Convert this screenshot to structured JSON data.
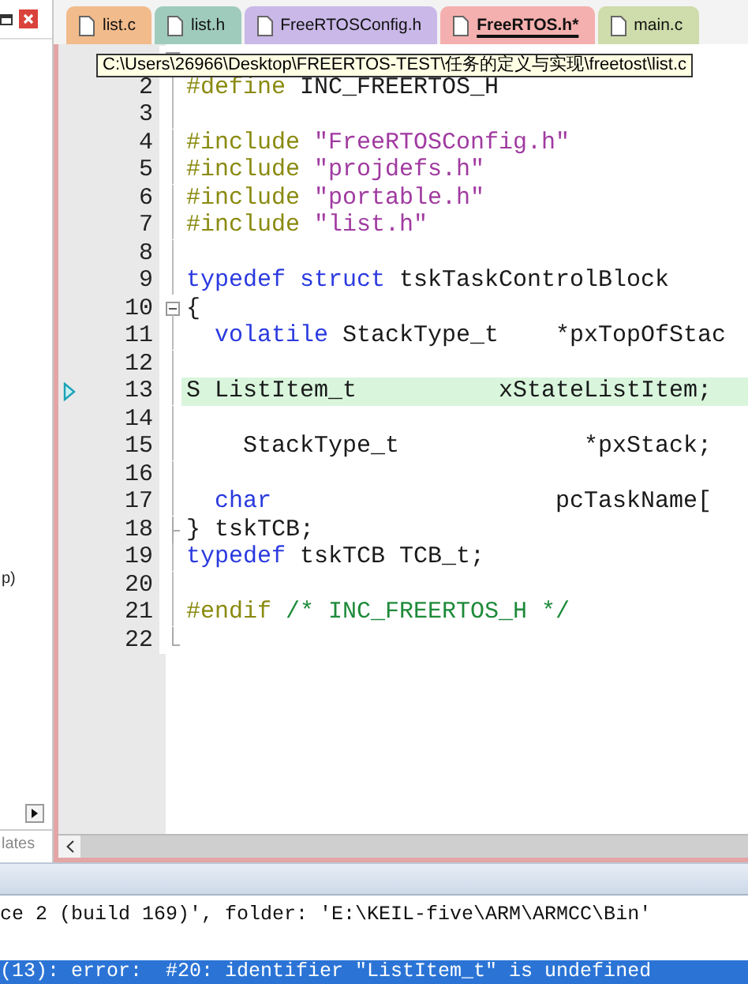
{
  "left_panel": {
    "texts": [
      "p)"
    ],
    "tab": "lates"
  },
  "tabs": [
    {
      "label": "list.c",
      "color": "#f2bb8c",
      "selected": false
    },
    {
      "label": "list.h",
      "color": "#9fcbbd",
      "selected": false
    },
    {
      "label": "FreeRTOSConfig.h",
      "color": "#c9b8e8",
      "selected": false
    },
    {
      "label": "FreeRTOS.h*",
      "color": "#f4b0ae",
      "selected": true
    },
    {
      "label": "main.c",
      "color": "#cfdcab",
      "selected": false
    }
  ],
  "tooltip": {
    "text": "C:\\Users\\26966\\Desktop\\FREERTOS-TEST\\任务的定义与实现\\freetost\\list.c"
  },
  "editor": {
    "lines": [
      {
        "kind": "fold_start",
        "current": false
      },
      {
        "number": "2",
        "kind": "body",
        "current": false,
        "tokens": [
          {
            "t": "#define",
            "kind": "pre"
          },
          {
            "t": " INC_FREERTOS_H",
            "kind": "plain"
          }
        ]
      },
      {
        "number": "3",
        "kind": "body",
        "current": false
      },
      {
        "number": "4",
        "kind": "body",
        "current": false,
        "tokens": [
          {
            "t": "#include",
            "kind": "pre"
          },
          {
            "t": " \"FreeRTOSConfig.h\"",
            "kind": "string"
          }
        ]
      },
      {
        "number": "5",
        "kind": "body",
        "current": false,
        "tokens": [
          {
            "t": "#include",
            "kind": "pre"
          },
          {
            "t": " \"projdefs.h\"",
            "kind": "string"
          }
        ]
      },
      {
        "number": "6",
        "kind": "body",
        "current": false,
        "tokens": [
          {
            "t": "#include",
            "kind": "pre"
          },
          {
            "t": " \"portable.h\"",
            "kind": "string"
          }
        ]
      },
      {
        "number": "7",
        "kind": "body",
        "current": false,
        "tokens": [
          {
            "t": "#include",
            "kind": "pre"
          },
          {
            "t": " \"list.h\"",
            "kind": "string"
          }
        ]
      },
      {
        "number": "8",
        "kind": "body",
        "current": false
      },
      {
        "number": "9",
        "kind": "body",
        "current": false,
        "tokens": [
          {
            "t": "typedef",
            "kind": "keyword"
          },
          {
            "t": " struct",
            "kind": "keyword"
          },
          {
            "t": " tskTaskControlBlock",
            "kind": "plain"
          }
        ]
      },
      {
        "number": "10",
        "kind": "fold_start",
        "current": false,
        "tokens": [
          {
            "t": "{",
            "kind": "plain"
          }
        ]
      },
      {
        "number": "11",
        "kind": "body",
        "current": false,
        "tokens": [
          {
            "t": "  volatile",
            "kind": "keyword"
          },
          {
            "t": " StackType_t    *pxTopOfStac",
            "kind": "plain"
          }
        ]
      },
      {
        "number": "12",
        "kind": "body",
        "current": false
      },
      {
        "number": "13",
        "kind": "body",
        "current": true,
        "tokens": [
          {
            "t": "S ListItem_t          xStateListItem;",
            "kind": "plain"
          }
        ]
      },
      {
        "number": "14",
        "kind": "body",
        "current": false
      },
      {
        "number": "15",
        "kind": "body",
        "current": false,
        "tokens": [
          {
            "t": "    StackType_t             *pxStack;",
            "kind": "plain"
          }
        ]
      },
      {
        "number": "16",
        "kind": "body",
        "current": false
      },
      {
        "number": "17",
        "kind": "body",
        "current": false,
        "tokens": [
          {
            "t": "  char",
            "kind": "keyword"
          },
          {
            "t": "                    pcTaskName[",
            "kind": "plain"
          }
        ]
      },
      {
        "number": "18",
        "kind": "fold_end",
        "current": false,
        "tokens": [
          {
            "t": "} tskTCB;",
            "kind": "plain"
          }
        ]
      },
      {
        "number": "19",
        "kind": "body",
        "current": false,
        "tokens": [
          {
            "t": "typedef",
            "kind": "keyword"
          },
          {
            "t": " tskTCB TCB_t;",
            "kind": "plain"
          }
        ]
      },
      {
        "number": "20",
        "kind": "body",
        "current": false
      },
      {
        "number": "21",
        "kind": "body",
        "current": false,
        "tokens": [
          {
            "t": "#endif",
            "kind": "pre"
          },
          {
            "t": " /* INC_FREERTOS_H */",
            "kind": "comment"
          }
        ]
      },
      {
        "number": "22",
        "kind": "last",
        "current": false
      }
    ]
  },
  "output": {
    "lines": [
      {
        "text": "ce 2 (build 169)', folder: 'E:\\KEIL-five\\ARM\\ARMCC\\Bin'",
        "selected": false
      },
      {
        "text": "(13): error:  #20: identifier \"ListItem_t\" is undefined",
        "selected": true
      }
    ]
  }
}
